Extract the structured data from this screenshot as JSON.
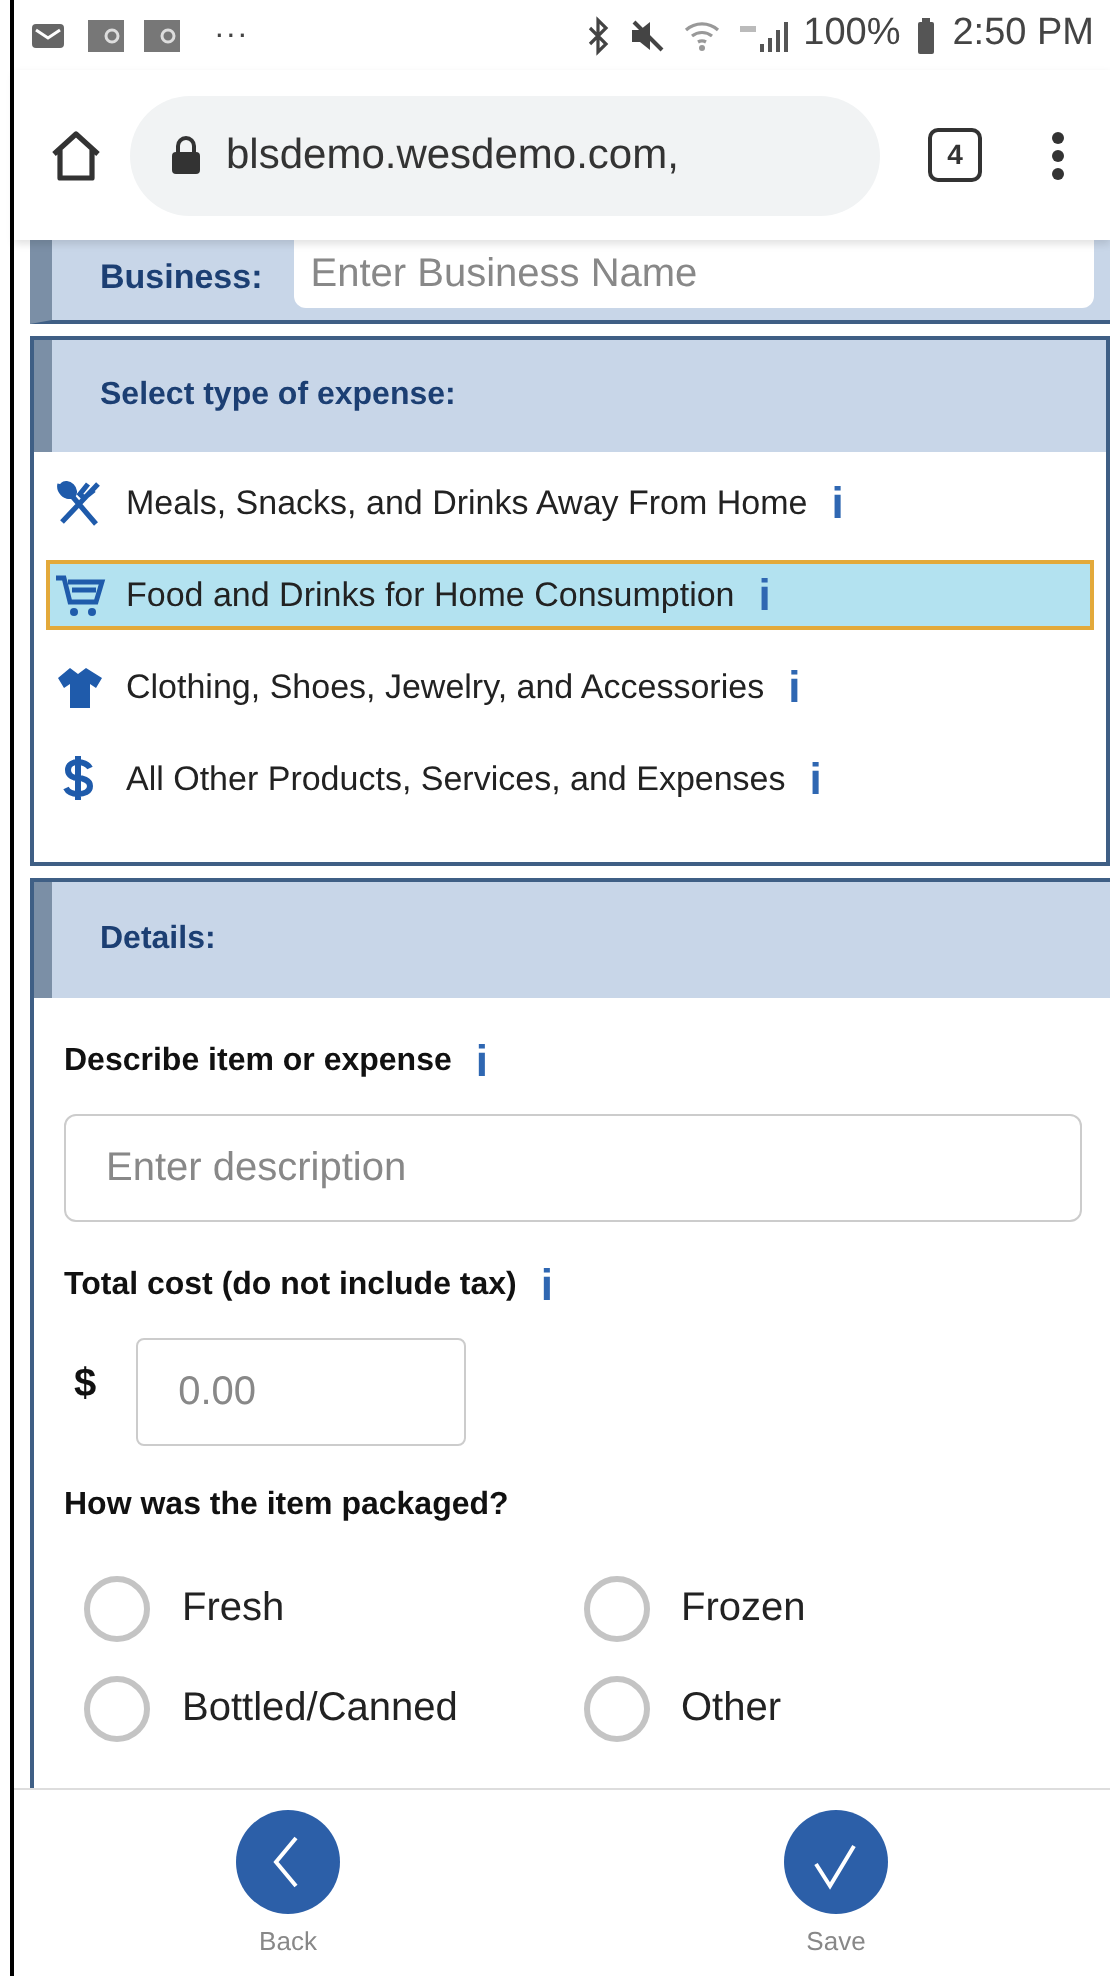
{
  "status_bar": {
    "more": "···",
    "battery": "100%",
    "time": "2:50 PM"
  },
  "browser": {
    "url": "blsdemo.wesdemo.com,",
    "tab_count": "4"
  },
  "business": {
    "label": "Business:",
    "placeholder": "Enter Business Name"
  },
  "expense_section": {
    "title": "Select type of expense:",
    "items": [
      {
        "kind": "meals",
        "label": "Meals, Snacks, and Drinks Away From Home",
        "info": "i",
        "selected": false
      },
      {
        "kind": "cart",
        "label": "Food and Drinks for Home Consumption",
        "info": "i",
        "selected": true
      },
      {
        "kind": "shirt",
        "label": "Clothing, Shoes, Jewelry, and Accessories",
        "info": "i",
        "selected": false
      },
      {
        "kind": "dollar",
        "label": "All Other Products, Services, and Expenses",
        "info": "i",
        "selected": false
      }
    ]
  },
  "details": {
    "title": "Details:",
    "describe": {
      "label": "Describe item or expense",
      "info": "i",
      "placeholder": "Enter description"
    },
    "cost": {
      "label": "Total cost (do not include tax)",
      "info": "i",
      "currency": "$",
      "placeholder": "0.00"
    },
    "packaging": {
      "label": "How was the item packaged?",
      "options": [
        {
          "label": "Fresh",
          "selected": false
        },
        {
          "label": "Frozen",
          "selected": false
        },
        {
          "label": "Bottled/Canned",
          "selected": false
        },
        {
          "label": "Other",
          "selected": false
        }
      ]
    }
  },
  "footer": {
    "buttons": [
      {
        "kind": "back",
        "label": "Back"
      },
      {
        "kind": "save",
        "label": "Save"
      }
    ]
  }
}
